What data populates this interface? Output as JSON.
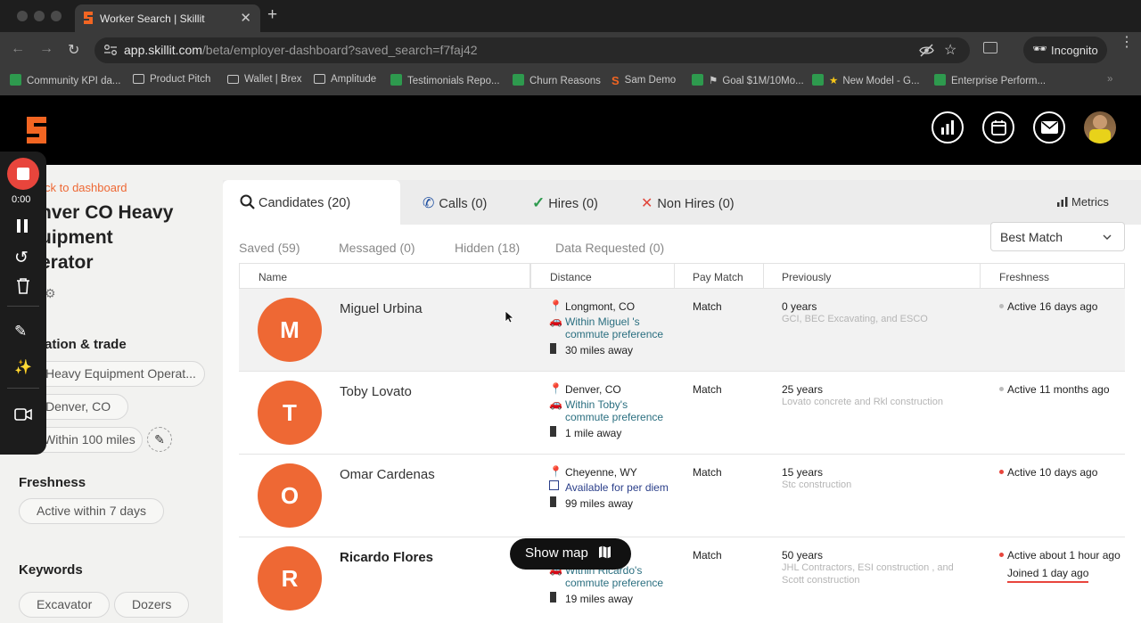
{
  "browser": {
    "tab_title": "Worker Search | Skillit",
    "url_domain": "app.skillit.com",
    "url_path": "/beta/employer-dashboard?saved_search=f7faj42",
    "incognito_label": "Incognito",
    "bookmarks": [
      {
        "label": "Community KPI da...",
        "icon": "sheet"
      },
      {
        "label": "Product Pitch",
        "icon": "folder"
      },
      {
        "label": "Wallet | Brex",
        "icon": "wallet"
      },
      {
        "label": "Amplitude",
        "icon": "folder"
      },
      {
        "label": "Testimonials Repo...",
        "icon": "sheet"
      },
      {
        "label": "Churn Reasons",
        "icon": "sheet"
      },
      {
        "label": "Sam Demo",
        "icon": "skillit"
      },
      {
        "label": "Goal $1M/10Mo...",
        "icon": "sheet"
      },
      {
        "label": "New Model - G...",
        "icon": "sheet"
      },
      {
        "label": "Enterprise Perform...",
        "icon": "sheet"
      }
    ]
  },
  "recorder": {
    "time": "0:00"
  },
  "sidebar": {
    "back_link": "ck to dashboard",
    "title_lines": [
      "nver CO Heavy",
      "uipment",
      "erator"
    ],
    "section_location": "ation & trade",
    "chips_location": [
      "Heavy Equipment Operat...",
      "Denver, CO",
      "Within 100 miles"
    ],
    "section_freshness": "Freshness",
    "chip_freshness": "Active within 7 days",
    "section_keywords": "Keywords",
    "chips_keywords": [
      "Excavator",
      "Dozers"
    ]
  },
  "tabs": [
    {
      "label": "Candidates (20)",
      "icon": "search"
    },
    {
      "label": "Calls (0)",
      "icon": "phone"
    },
    {
      "label": "Hires (0)",
      "icon": "check"
    },
    {
      "label": "Non Hires (0)",
      "icon": "x"
    }
  ],
  "metrics_label": "Metrics",
  "subtabs": [
    "Saved (59)",
    "Messaged (0)",
    "Hidden (18)",
    "Data Requested (0)"
  ],
  "sort": {
    "selected": "Best Match"
  },
  "table": {
    "headers": [
      "Name",
      "Distance",
      "Pay Match",
      "Previously",
      "Freshness"
    ],
    "rows": [
      {
        "initial": "M",
        "name": "Miguel Urbina",
        "location": "Longmont, CO",
        "detail": "Within Miguel 's",
        "detail2": "commute preference",
        "miles": "30 miles away",
        "pay": "Match",
        "years": "0 years",
        "companies": "GCI, BEC Excavating, and ESCO",
        "companies2": "",
        "fresh": "Active 16 days ago",
        "fresh2": "",
        "dot": "#bbbbbb",
        "detail_icon": "car"
      },
      {
        "initial": "T",
        "name": "Toby Lovato",
        "location": "Denver, CO",
        "detail": "Within Toby's",
        "detail2": "commute preference",
        "miles": "1 mile away",
        "pay": "Match",
        "years": "25 years",
        "companies": "Lovato concrete and Rkl construction",
        "companies2": "",
        "fresh": "Active 11 months ago",
        "fresh2": "",
        "dot": "#bbbbbb",
        "detail_icon": "car"
      },
      {
        "initial": "O",
        "name": "Omar Cardenas",
        "location": "Cheyenne, WY",
        "detail": "Available for per diem",
        "detail2": "",
        "miles": "99 miles away",
        "pay": "Match",
        "years": "15 years",
        "companies": "Stc construction",
        "companies2": "",
        "fresh": "Active 10 days ago",
        "fresh2": "",
        "dot": "#e8453c",
        "detail_icon": "map"
      },
      {
        "initial": "R",
        "name": "Ricardo Flores",
        "location": "",
        "detail": "Within Ricardo's",
        "detail2": "commute preference",
        "miles": "19 miles away",
        "pay": "Match",
        "years": "50 years",
        "companies": "JHL Contractors, ESI construction , and",
        "companies2": "Scott construction",
        "fresh": "Active about 1 hour ago",
        "fresh2": "Joined 1 day ago",
        "dot": "#e8453c",
        "detail_icon": "car"
      }
    ]
  },
  "show_map_label": "Show map",
  "colors": {
    "brand": "#f26522",
    "avatar": "#ee6834",
    "teal": "#2b6f80"
  }
}
